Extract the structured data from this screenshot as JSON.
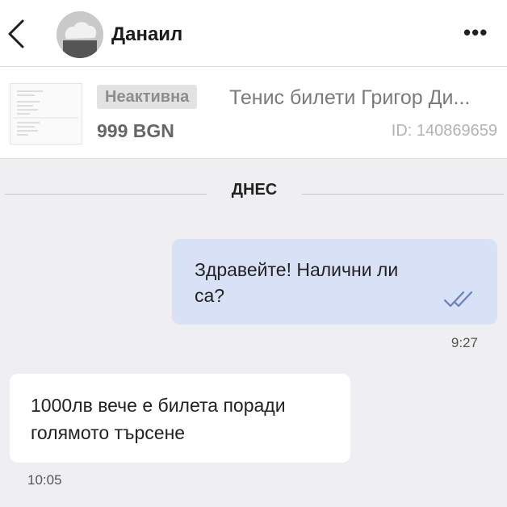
{
  "header": {
    "back_icon": "chevron-left-icon",
    "contact_name": "Данаил",
    "menu_icon": "more-dots-icon",
    "menu_glyph": "•••"
  },
  "listing": {
    "status": "Неактивна",
    "title": "Тенис билети Григор Ди...",
    "price": "999 BGN",
    "id_text": "ID: 140869659"
  },
  "chat": {
    "day_separator": "ДНЕС",
    "messages": [
      {
        "direction": "outgoing",
        "lines": [
          "Здравейте! Налични ли",
          "са?"
        ],
        "time": "9:27",
        "status_icon": "double-check-icon"
      },
      {
        "direction": "incoming",
        "lines": [
          "1000лв вече е билета поради",
          "голямото търсене"
        ],
        "time": "10:05"
      }
    ]
  },
  "colors": {
    "outgoing_bubble": "#d8e1f6",
    "incoming_bubble": "#ffffff",
    "chat_background": "#efeff1",
    "read_check": "#6b7fbd"
  }
}
